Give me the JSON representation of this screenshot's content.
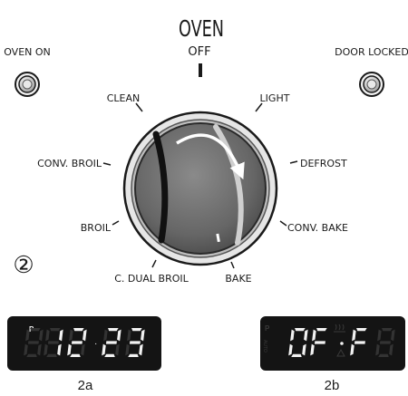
{
  "panel": {
    "title": "OVEN",
    "off_label": "OFF",
    "oven_on_label": "OVEN ON",
    "door_locked_label": "DOOR LOCKED",
    "figure_number": "②"
  },
  "knob": {
    "settings": {
      "clean": "CLEAN",
      "light": "LIGHT",
      "conv_broil": "CONV. BROIL",
      "defrost": "DEFROST",
      "broil": "BROIL",
      "conv_bake": "CONV. BAKE",
      "c_dual_broil": "C. DUAL BROIL",
      "bake": "BAKE"
    }
  },
  "displays": {
    "a": {
      "indicator": "P",
      "digits": [
        "1",
        "2",
        "2",
        "3"
      ],
      "caption": "2a"
    },
    "b": {
      "indicator": "P",
      "auto_label": "AUTO",
      "digits": [
        "0",
        "F",
        "F"
      ],
      "caption": "2b"
    }
  },
  "colors": {
    "ink": "#1a1a1a",
    "knob_face": "#6a6a6a",
    "bezel": "#d0d0d0",
    "display_bg": "#141414",
    "segment_on": "#f2f2f2",
    "segment_off": "#333333"
  }
}
